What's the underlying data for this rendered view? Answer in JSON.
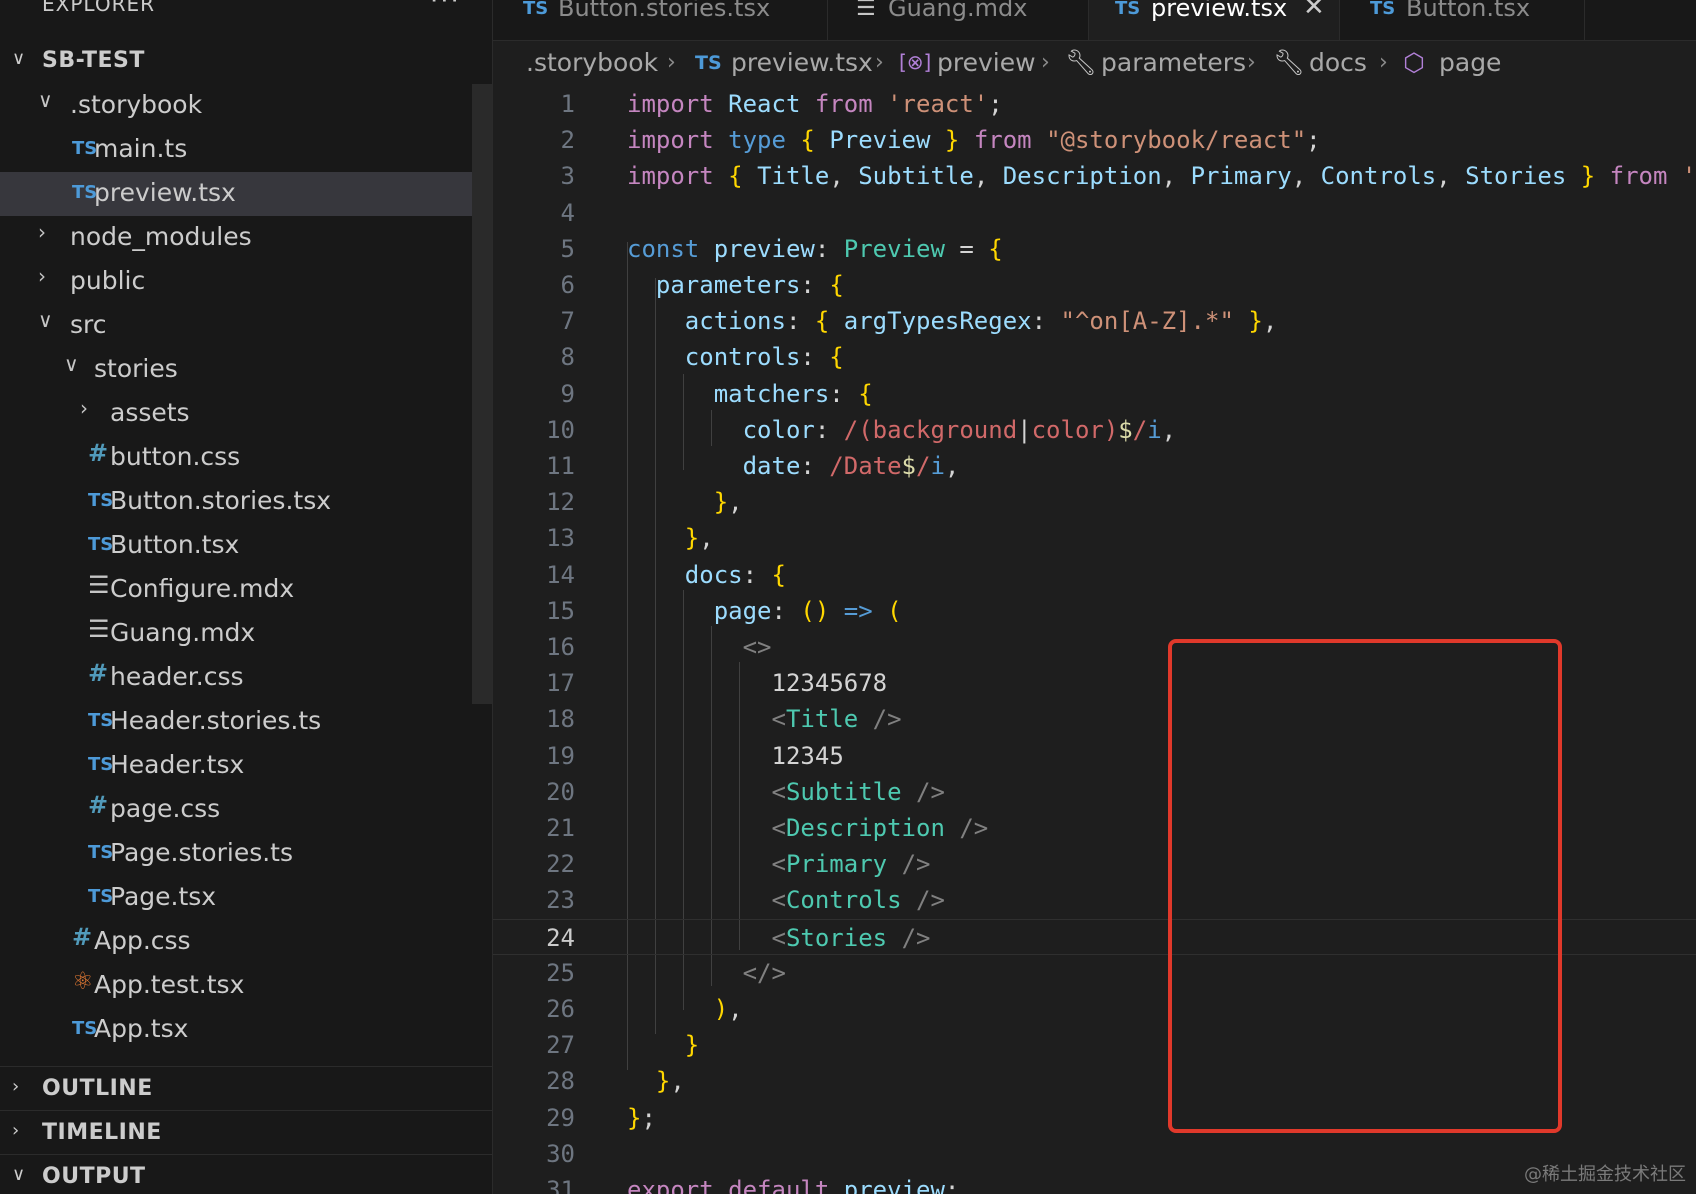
{
  "sidebar": {
    "header_title": "EXPLORER",
    "more_icon": "···",
    "project": "SB-TEST",
    "tree": [
      {
        "name": ".storybook",
        "kind": "folder",
        "open": true
      },
      {
        "name": "main.ts",
        "kind": "ts"
      },
      {
        "name": "preview.tsx",
        "kind": "ts",
        "selected": true
      },
      {
        "name": "node_modules",
        "kind": "folder",
        "open": false
      },
      {
        "name": "public",
        "kind": "folder",
        "open": false
      },
      {
        "name": "src",
        "kind": "folder",
        "open": true
      },
      {
        "name": "stories",
        "kind": "folder",
        "open": true
      },
      {
        "name": "assets",
        "kind": "folder",
        "open": false
      },
      {
        "name": "button.css",
        "kind": "css"
      },
      {
        "name": "Button.stories.tsx",
        "kind": "ts"
      },
      {
        "name": "Button.tsx",
        "kind": "ts"
      },
      {
        "name": "Configure.mdx",
        "kind": "mdx"
      },
      {
        "name": "Guang.mdx",
        "kind": "mdx"
      },
      {
        "name": "header.css",
        "kind": "css"
      },
      {
        "name": "Header.stories.ts",
        "kind": "ts"
      },
      {
        "name": "Header.tsx",
        "kind": "ts"
      },
      {
        "name": "page.css",
        "kind": "css"
      },
      {
        "name": "Page.stories.ts",
        "kind": "ts"
      },
      {
        "name": "Page.tsx",
        "kind": "ts"
      },
      {
        "name": "App.css",
        "kind": "css"
      },
      {
        "name": "App.test.tsx",
        "kind": "react"
      },
      {
        "name": "App.tsx",
        "kind": "ts"
      }
    ],
    "sections": {
      "outline": "OUTLINE",
      "timeline": "TIMELINE",
      "output": "OUTPUT"
    }
  },
  "tabs": [
    {
      "label": "Button.stories.tsx",
      "icon": "TS",
      "active": false
    },
    {
      "label": "Guang.mdx",
      "icon": "mdx",
      "active": false
    },
    {
      "label": "preview.tsx",
      "icon": "TS",
      "active": true
    },
    {
      "label": "Button.tsx",
      "icon": "TS",
      "active": false
    }
  ],
  "breadcrumb": [
    ".storybook",
    "preview.tsx",
    "preview",
    "parameters",
    "docs",
    "page"
  ],
  "ts_badge": "TS",
  "code": {
    "current_line": 24,
    "lines": [
      "import React from 'react';",
      "import type { Preview } from \"@storybook/react\";",
      "import { Title, Subtitle, Description, Primary, Controls, Stories } from '",
      "",
      "const preview: Preview = {",
      "  parameters: {",
      "    actions: { argTypesRegex: \"^on[A-Z].*\" },",
      "    controls: {",
      "      matchers: {",
      "        color: /(background|color)$/i,",
      "        date: /Date$/i,",
      "      },",
      "    },",
      "    docs: {",
      "      page: () => (",
      "        <>",
      "          12345678",
      "          <Title />",
      "          12345",
      "          <Subtitle />",
      "          <Description />",
      "          <Primary />",
      "          <Controls />",
      "          <Stories />",
      "        </>",
      "      ),",
      "    }",
      "  },",
      "};",
      "",
      "export default preview;"
    ]
  },
  "watermark": "@稀土掘金技术社区"
}
